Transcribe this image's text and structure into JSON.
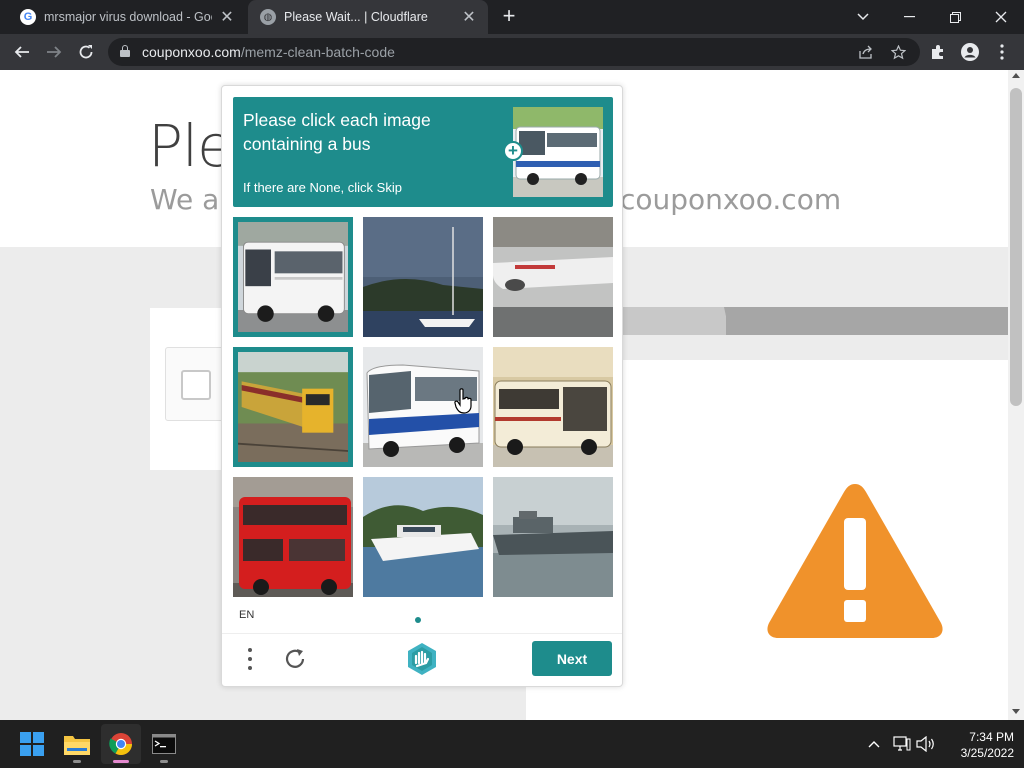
{
  "tabs": [
    {
      "title": "mrsmajor virus download - Goog",
      "favicon": "google-icon",
      "active": false
    },
    {
      "title": "Please Wait... | Cloudflare",
      "favicon": "globe-icon",
      "active": true
    }
  ],
  "omnibox": {
    "domain": "couponxoo.com",
    "path": "/memz-clean-batch-code"
  },
  "page": {
    "title": "Ple",
    "subtitle_left": "We ar",
    "subtitle_right": "couponxoo.com"
  },
  "captcha": {
    "prompt": "Please click each image containing a bus",
    "skip_hint": "If there are None, click Skip",
    "language": "EN",
    "next_label": "Next",
    "images": [
      {
        "subject": "white-bus",
        "selected": true
      },
      {
        "subject": "sailboat",
        "selected": false
      },
      {
        "subject": "airplane",
        "selected": false
      },
      {
        "subject": "train",
        "selected": true
      },
      {
        "subject": "blue-white-bus",
        "selected": false
      },
      {
        "subject": "cream-bus",
        "selected": false
      },
      {
        "subject": "red-double-decker-bus",
        "selected": false
      },
      {
        "subject": "yacht",
        "selected": false
      },
      {
        "subject": "ship",
        "selected": false
      }
    ],
    "accent_color": "#1e8c8c"
  },
  "taskbar": {
    "apps": [
      "windows-start-icon",
      "file-explorer-icon",
      "chrome-icon",
      "terminal-icon"
    ],
    "time": "7:34 PM",
    "date": "3/25/2022"
  },
  "colors": {
    "warning": "#f0922b"
  }
}
